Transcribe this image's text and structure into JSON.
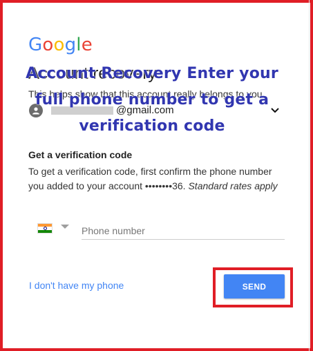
{
  "overlay": {
    "line1": "Account Recovery Enter your",
    "line2": "full phone number to get a",
    "line3": "verification code"
  },
  "header": {
    "logo_letters": [
      "G",
      "o",
      "o",
      "g",
      "l",
      "e"
    ],
    "title": "Account recovery",
    "subtitle": "This helps show that this account really belongs to you"
  },
  "account": {
    "email_suffix": "@gmail.com",
    "avatar_icon": "account-circle-icon",
    "chevron_icon": "chevron-down-icon"
  },
  "section": {
    "heading": "Get a verification code",
    "description_main": "To get a verification code, first confirm the phone number you added to your account ••••••••36.",
    "description_note": "Standard rates apply"
  },
  "phone": {
    "country_flag": "india-flag-icon",
    "placeholder": "Phone number",
    "value": ""
  },
  "actions": {
    "no_phone_label": "I don't have my phone",
    "send_label": "SEND"
  },
  "colors": {
    "accent": "#4285F4",
    "highlight": "#e01e26",
    "overlay_text": "#3136b0"
  }
}
